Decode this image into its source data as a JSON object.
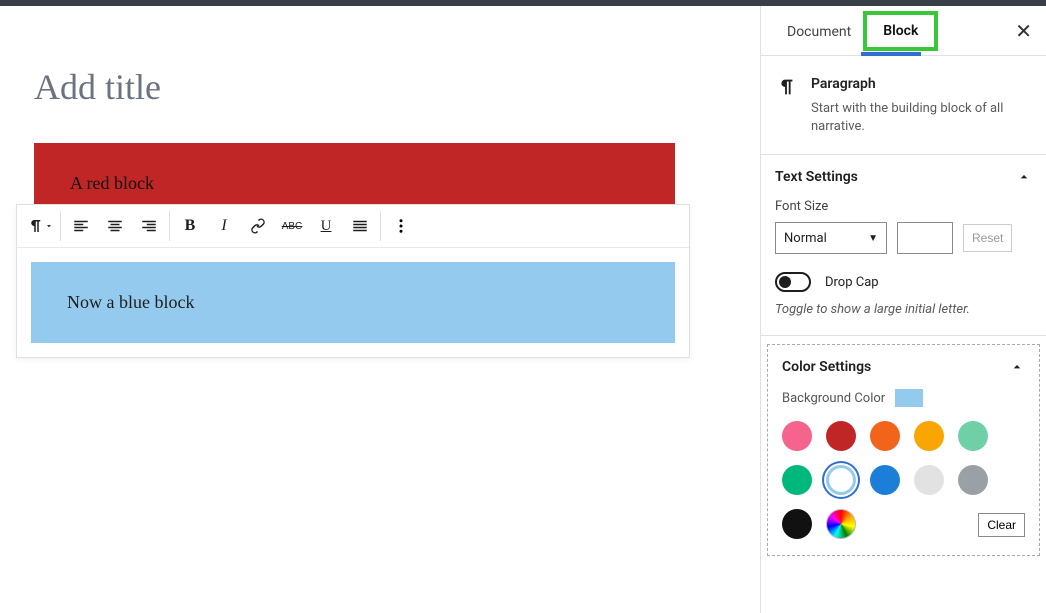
{
  "title_placeholder": "Add title",
  "red_block_text": "A red block",
  "blue_block_text": "Now a blue block",
  "sidebar": {
    "tabs": {
      "document": "Document",
      "block": "Block"
    },
    "block_info": {
      "name": "Paragraph",
      "desc": "Start with the building block of all narrative."
    },
    "text_settings": {
      "title": "Text Settings",
      "font_size_label": "Font Size",
      "font_size_value": "Normal",
      "reset": "Reset",
      "drop_cap": "Drop Cap",
      "drop_cap_hint": "Toggle to show a large initial letter."
    },
    "color_settings": {
      "title": "Color Settings",
      "bg_label": "Background Color",
      "bg_swatch": "#94caed",
      "clear": "Clear",
      "colors": [
        "#f6638d",
        "#c02626",
        "#f26419",
        "#f9a602",
        "#6fd0a7",
        "#00b87c",
        "#94caed",
        "#1c7ed6",
        "#e2e2e2",
        "#9aa0a6",
        "#111111"
      ],
      "selected_index": 6
    }
  }
}
